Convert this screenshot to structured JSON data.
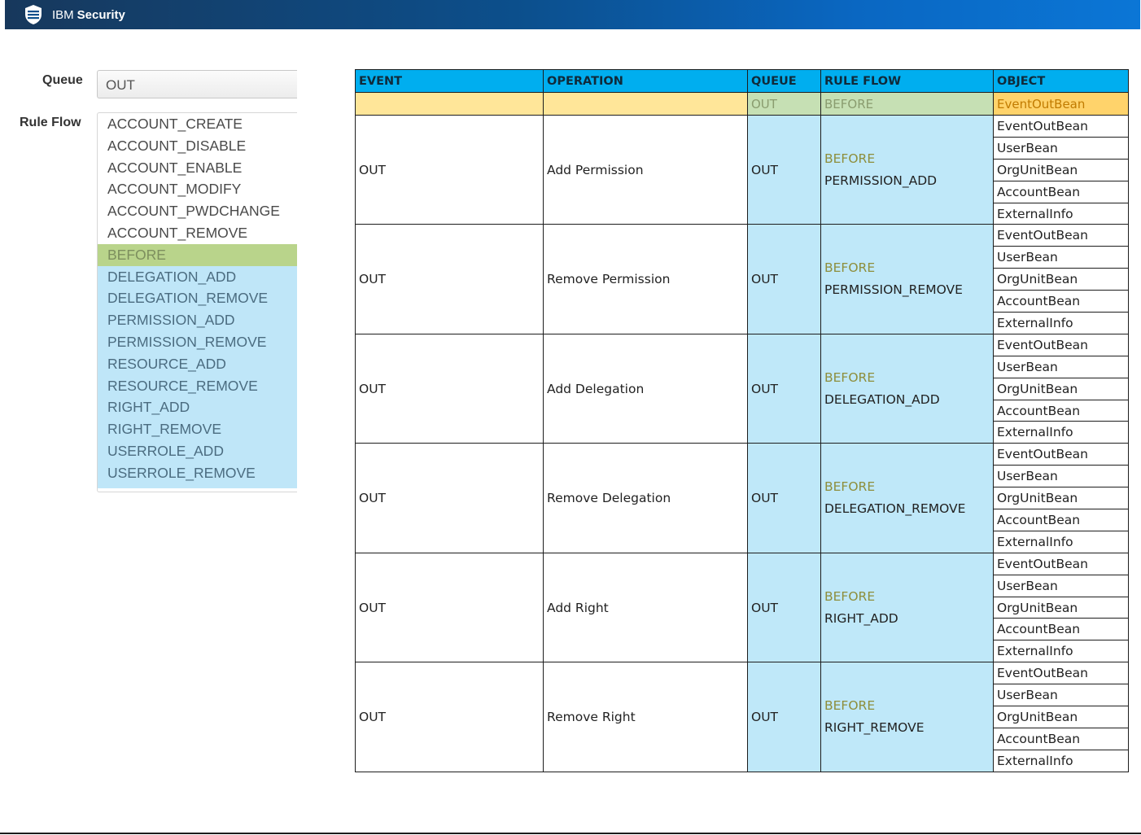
{
  "header": {
    "brand_main": "IBM",
    "brand_bold": "Security",
    "colors": {
      "bar_left": "#17385c",
      "bar_right": "#0b76d6"
    }
  },
  "form": {
    "queue_label": "Queue",
    "queue_value": "OUT",
    "rule_flow_label": "Rule Flow",
    "rule_flow_items": [
      "ACCOUNT_CREATE",
      "ACCOUNT_DISABLE",
      "ACCOUNT_ENABLE",
      "ACCOUNT_MODIFY",
      "ACCOUNT_PWDCHANGE",
      "ACCOUNT_REMOVE",
      "BEFORE",
      "DELEGATION_ADD",
      "DELEGATION_REMOVE",
      "PERMISSION_ADD",
      "PERMISSION_REMOVE",
      "RESOURCE_ADD",
      "RESOURCE_REMOVE",
      "RIGHT_ADD",
      "RIGHT_REMOVE",
      "USERROLE_ADD",
      "USERROLE_REMOVE"
    ],
    "selected_item": "BEFORE"
  },
  "table": {
    "headers": [
      "EVENT",
      "OPERATION",
      "QUEUE",
      "RULE FLOW",
      "OBJECT"
    ],
    "summary_row": {
      "queue": "OUT",
      "rule_flow": "BEFORE",
      "object": "EventOutBean"
    },
    "rows": [
      {
        "event": "OUT",
        "operation": "Add Permission",
        "queue": "OUT",
        "flow_prefix": "BEFORE",
        "flow_name": "PERMISSION_ADD",
        "objects": [
          "EventOutBean",
          "UserBean",
          "OrgUnitBean",
          "AccountBean",
          "ExternalInfo"
        ]
      },
      {
        "event": "OUT",
        "operation": "Remove Permission",
        "queue": "OUT",
        "flow_prefix": "BEFORE",
        "flow_name": "PERMISSION_REMOVE",
        "objects": [
          "EventOutBean",
          "UserBean",
          "OrgUnitBean",
          "AccountBean",
          "ExternalInfo"
        ]
      },
      {
        "event": "OUT",
        "operation": "Add Delegation",
        "queue": "OUT",
        "flow_prefix": "BEFORE",
        "flow_name": "DELEGATION_ADD",
        "objects": [
          "EventOutBean",
          "UserBean",
          "OrgUnitBean",
          "AccountBean",
          "ExternalInfo"
        ]
      },
      {
        "event": "OUT",
        "operation": "Remove Delegation",
        "queue": "OUT",
        "flow_prefix": "BEFORE",
        "flow_name": "DELEGATION_REMOVE",
        "objects": [
          "EventOutBean",
          "UserBean",
          "OrgUnitBean",
          "AccountBean",
          "ExternalInfo"
        ]
      },
      {
        "event": "OUT",
        "operation": "Add Right",
        "queue": "OUT",
        "flow_prefix": "BEFORE",
        "flow_name": "RIGHT_ADD",
        "objects": [
          "EventOutBean",
          "UserBean",
          "OrgUnitBean",
          "AccountBean",
          "ExternalInfo"
        ]
      },
      {
        "event": "OUT",
        "operation": "Remove Right",
        "queue": "OUT",
        "flow_prefix": "BEFORE",
        "flow_name": "RIGHT_REMOVE",
        "objects": [
          "EventOutBean",
          "UserBean",
          "OrgUnitBean",
          "AccountBean",
          "ExternalInfo"
        ]
      }
    ]
  }
}
